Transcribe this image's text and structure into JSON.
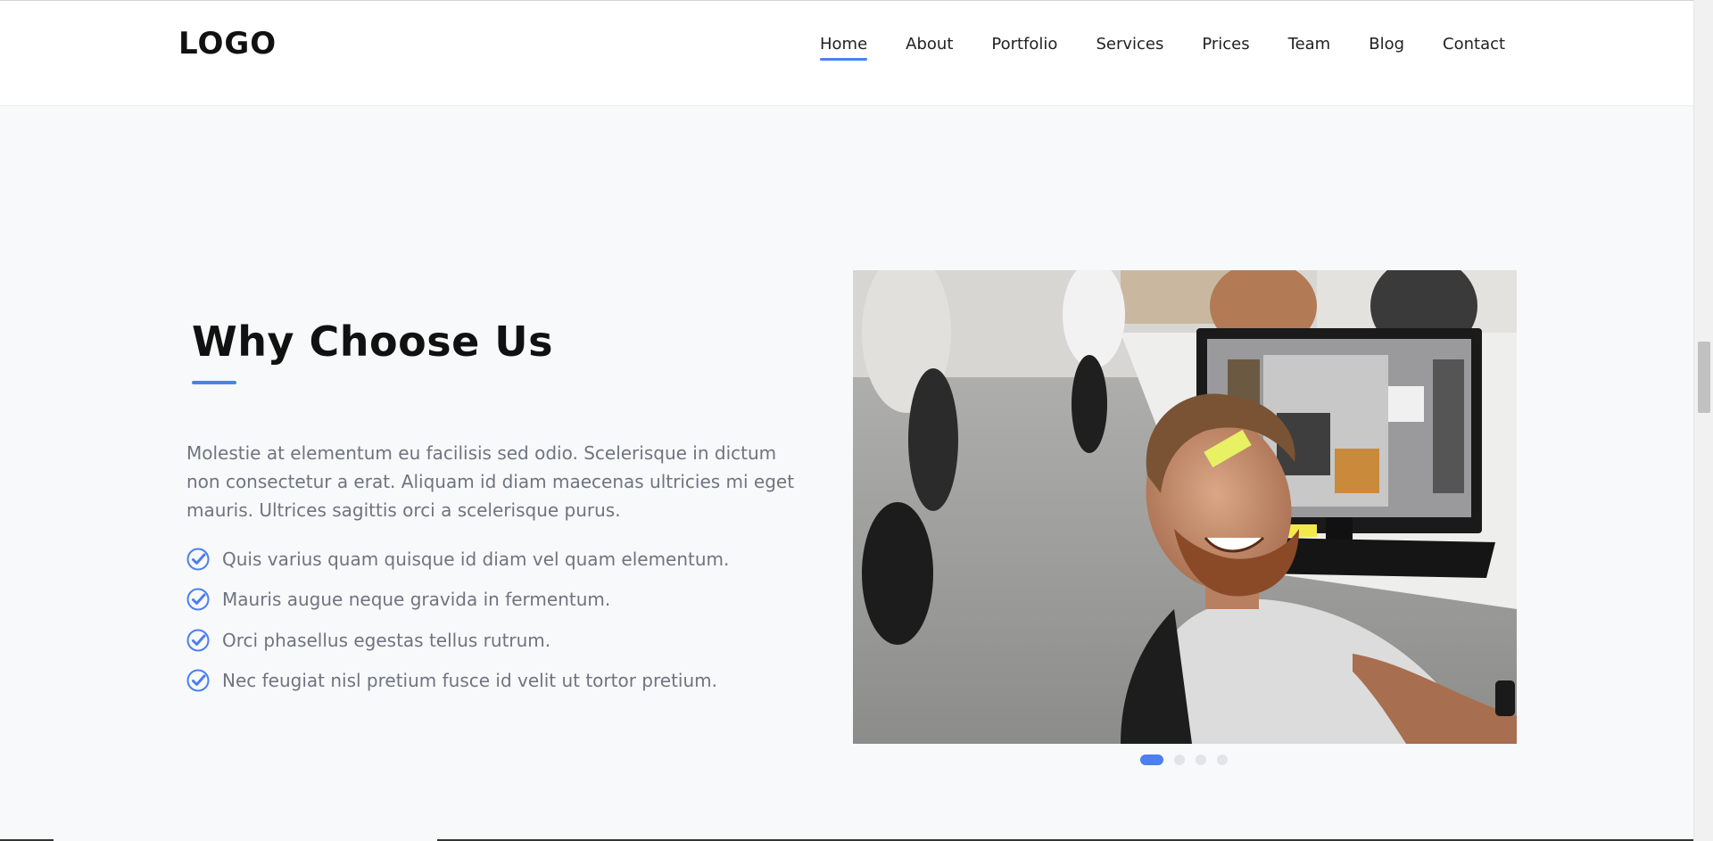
{
  "header": {
    "logo": "LOGO",
    "nav": [
      {
        "label": "Home",
        "active": true
      },
      {
        "label": "About"
      },
      {
        "label": "Portfolio"
      },
      {
        "label": "Services"
      },
      {
        "label": "Prices"
      },
      {
        "label": "Team"
      },
      {
        "label": "Blog"
      },
      {
        "label": "Contact"
      }
    ]
  },
  "section": {
    "title": "Why Choose Us",
    "intro": "Molestie at elementum eu facilisis sed odio. Scelerisque in dictum non consectetur a erat. Aliquam id diam maecenas ultricies mi eget mauris. Ultrices sagittis orci a scelerisque purus.",
    "features": [
      "Quis varius quam quisque id diam vel quam elementum.",
      "Mauris augue neque gravida in fermentum.",
      "Orci phasellus egestas tellus rutrum.",
      "Nec feugiat nisl pretium fusce id velit ut tortor pretium."
    ],
    "feature_icon": "check-circle-icon"
  },
  "slider": {
    "image_description_icon": "office-photo",
    "slide_count": 4,
    "active_slide": 1
  },
  "colors": {
    "accent": "#4c7ff0",
    "text_muted": "#6e7480",
    "heading": "#111111",
    "background": "#f8f9fa"
  }
}
